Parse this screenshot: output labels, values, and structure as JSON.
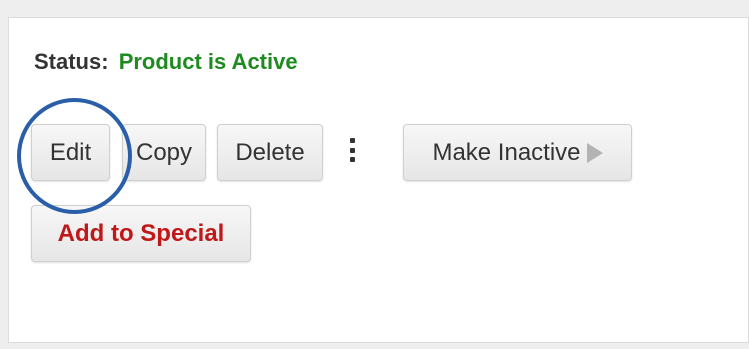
{
  "status": {
    "label": "Status:",
    "value": "Product is Active",
    "value_color": "#1f8a1f"
  },
  "actions": {
    "edit_label": "Edit",
    "copy_label": "Copy",
    "delete_label": "Delete",
    "more_icon": "kebab-menu-icon",
    "make_inactive_label": "Make Inactive",
    "make_inactive_icon": "play-icon",
    "add_to_special_label": "Add to Special",
    "add_to_special_color": "#c01818"
  },
  "annotation": {
    "highlight_color": "#2a5ea8",
    "highlighted_element": "edit-button"
  }
}
